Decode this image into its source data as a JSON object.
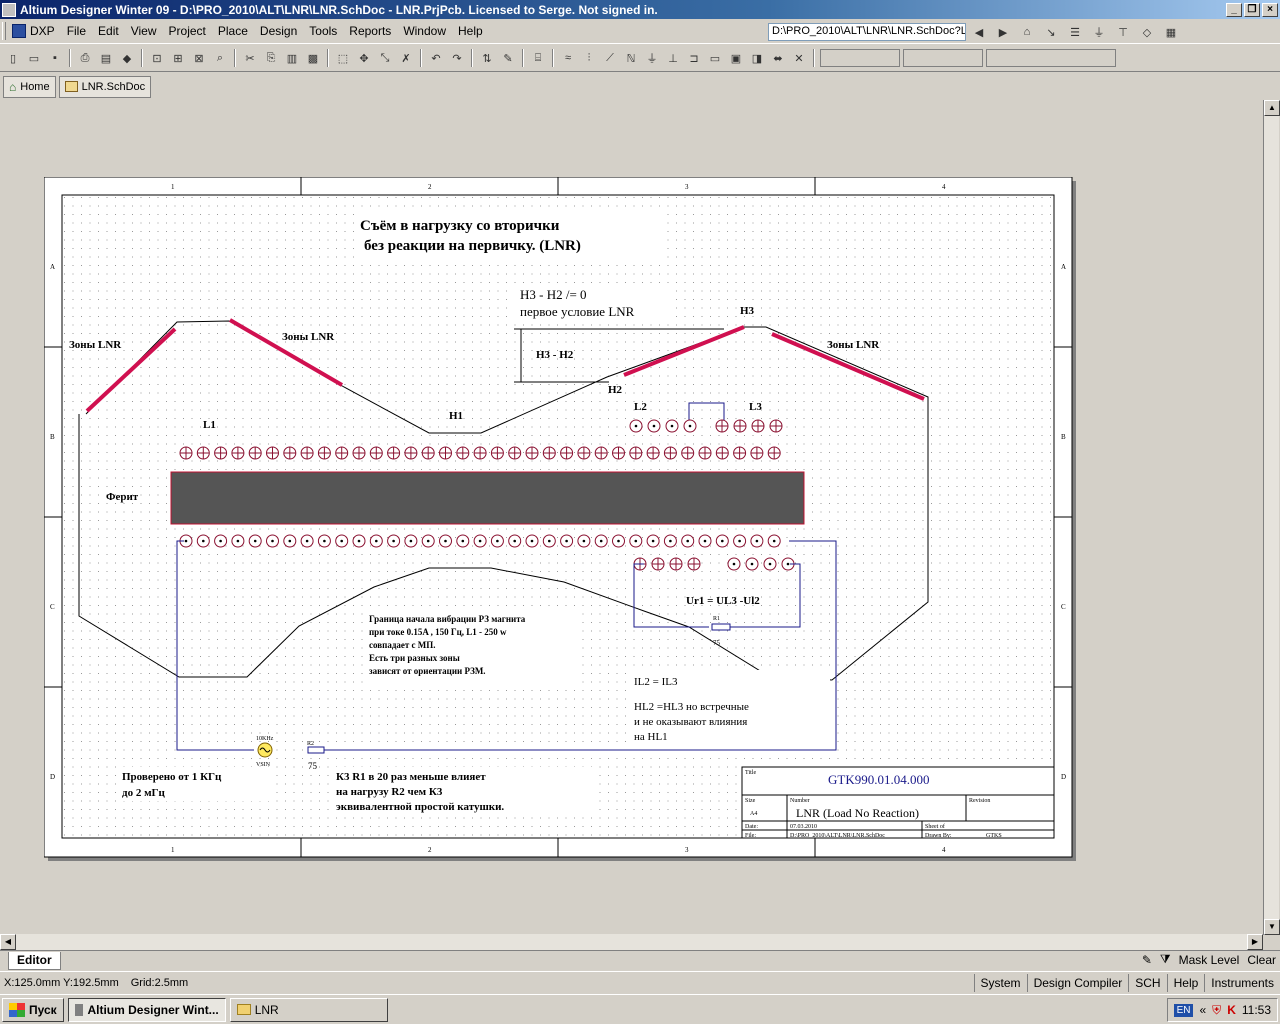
{
  "window": {
    "title": "Altium Designer Winter 09 - D:\\PRO_2010\\ALT\\LNR\\LNR.SchDoc - LNR.PrjPcb. Licensed to Serge. Not signed in."
  },
  "menu": {
    "dxp": "DXP",
    "items": [
      "File",
      "Edit",
      "View",
      "Project",
      "Place",
      "Design",
      "Tools",
      "Reports",
      "Window",
      "Help"
    ]
  },
  "path_box": "D:\\PRO_2010\\ALT\\LNR\\LNR.SchDoc?L",
  "tabs": {
    "home": "Home",
    "doc": "LNR.SchDoc"
  },
  "schematic": {
    "title_line1": "Съём  в  нагрузку  со  вторички",
    "title_line2": "без  реакции  на  первичку.  (LNR)",
    "cond_line1": "H3 - H2 /= 0",
    "cond_line2": "первое  условие  LNR",
    "h3_h2": "H3 - H2",
    "h3": "H3",
    "h2": "H2",
    "h1": "H1",
    "zone": "Зоны  LNR",
    "l1": "L1",
    "l2": "L2",
    "l3": "L3",
    "ferrite": "Ферит",
    "ur1": "Ur1 = UL3 -Ul2",
    "r1_label": "R1",
    "r1_value": "75",
    "note_lines": [
      "Граница  начала  вибрации   РЗ магнита",
      "при  токе 0.15A , 150 Гц,  L1 - 250 w",
      "совпадает  с   МП.",
      "Есть  три  разных  зоны",
      "зависят  от  ориентации  РЗМ."
    ],
    "il_eq": "IL2 = IL3",
    "hl_lines": [
      "HL2 =HL3  но  встречные",
      "и  не  оказывают  влияния",
      "на  HL1"
    ],
    "source_top": "10KHz",
    "source_bottom": "VSIN",
    "r2_label": "R2",
    "r2_value": "75",
    "tested_lines": [
      "Проверено  от  1 КГц",
      "до 2 мГц"
    ],
    "k3_lines": [
      "К3  R1 в 20 раз меньше  влияет",
      "на  нагрузу  R2  чем  К3",
      "эквивалентной  простой  катушки."
    ],
    "border_cols": [
      "1",
      "2",
      "3",
      "4"
    ],
    "border_rows": [
      "A",
      "B",
      "C",
      "D"
    ],
    "titleblock": {
      "title_label": "Title",
      "doc_number": "GTK990.01.04.000",
      "size_label": "Size",
      "size_value": "A4",
      "number_label": "Number",
      "doc_title": "LNR (Load No Reaction)",
      "revision_label": "Revision",
      "date_label": "Date:",
      "date_value": "07.03.2010",
      "sheet_label": "Sheet   of",
      "file_label": "File:",
      "file_value": "D:\\PRO_2010\\ALT\\LNR\\LNR.SchDoc",
      "drawn_label": "Drawn By:",
      "drawn_value": "GTKS"
    }
  },
  "editor": {
    "tab": "Editor",
    "mask_level": "Mask Level",
    "clear": "Clear"
  },
  "status": {
    "coords": "X:125.0mm Y:192.5mm",
    "grid": "Grid:2.5mm",
    "panels": [
      "System",
      "Design Compiler",
      "SCH",
      "Help",
      "Instruments"
    ]
  },
  "taskbar": {
    "start": "Пуск",
    "items": [
      "Altium Designer Wint...",
      "LNR"
    ],
    "lang": "EN",
    "clock": "11:53"
  }
}
